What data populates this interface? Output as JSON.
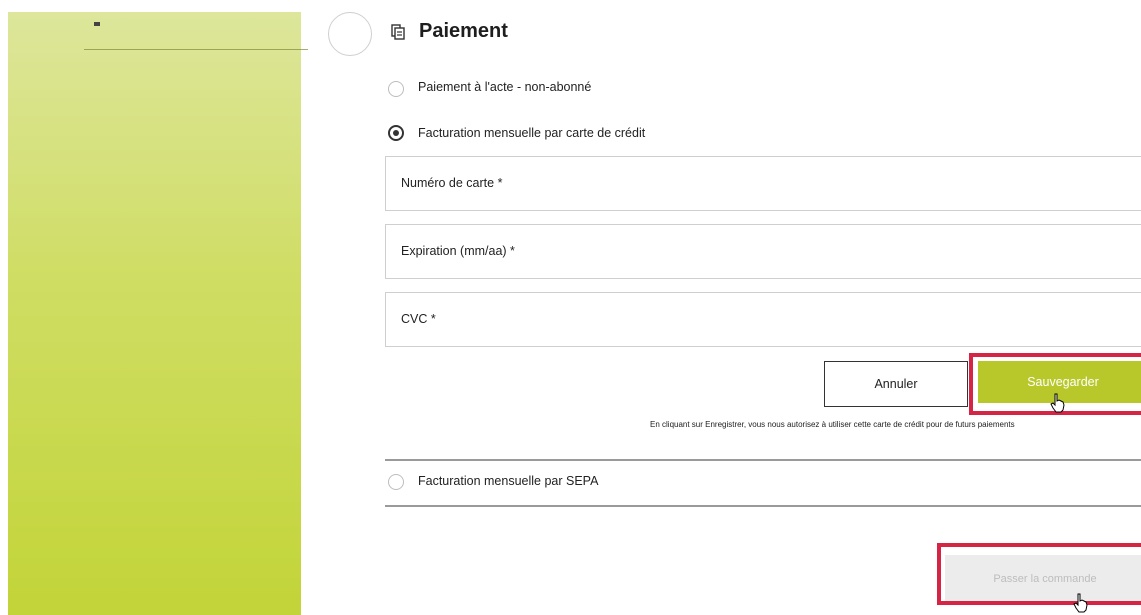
{
  "payment": {
    "title": "Paiement",
    "options": [
      {
        "label": "Paiement à l'acte - non-abonné",
        "selected": false
      },
      {
        "label": "Facturation mensuelle par carte de crédit",
        "selected": true
      },
      {
        "label": "Facturation mensuelle par SEPA",
        "selected": false
      }
    ],
    "fields": {
      "card_number": "Numéro de carte *",
      "expiration": "Expiration (mm/aa) *",
      "cvc": "CVC *"
    },
    "buttons": {
      "cancel": "Annuler",
      "save": "Sauvegarder",
      "order": "Passer la commande"
    },
    "consent_text": "En cliquant sur Enregistrer, vous nous autorisez à utiliser cette carte de crédit pour de futurs paiements"
  },
  "colors": {
    "accent": "#b8c82a",
    "highlight": "#d62445",
    "sidebar_top": "#dde69b",
    "sidebar_bottom": "#c2d438"
  },
  "icons": {
    "title": "payment-icon",
    "cursor": "hand-pointer-icon"
  }
}
